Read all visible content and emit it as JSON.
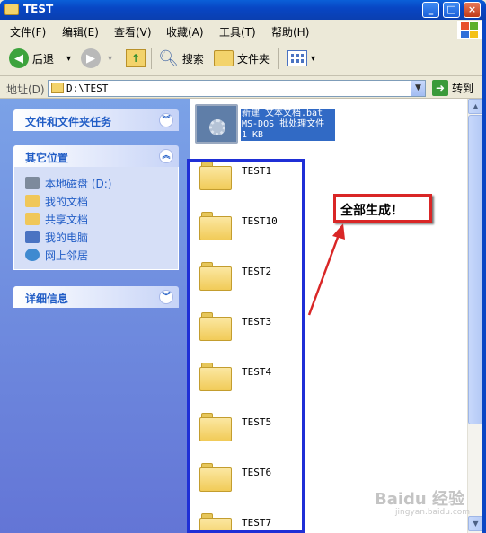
{
  "window": {
    "title": "TEST",
    "min_label": "_",
    "max_label": "□",
    "close_label": "×"
  },
  "menu": [
    "文件(F)",
    "编辑(E)",
    "查看(V)",
    "收藏(A)",
    "工具(T)",
    "帮助(H)"
  ],
  "toolbar": {
    "back_label": "后退",
    "back_arrow": "▾",
    "forward_arrow": "▾",
    "search_label": "搜索",
    "folders_label": "文件夹",
    "view_arrow": "▾"
  },
  "address": {
    "label": "地址(D)",
    "value": "D:\\TEST",
    "go_label": "转到"
  },
  "taskpane": {
    "file_tasks_title": "文件和文件夹任务",
    "other_places_title": "其它位置",
    "other_places": [
      {
        "label": "本地磁盘 (D:)",
        "icon": "drive-icon",
        "color": "#7d8a9c"
      },
      {
        "label": "我的文档",
        "icon": "my-documents-icon",
        "color": "#f0c75a"
      },
      {
        "label": "共享文档",
        "icon": "shared-documents-icon",
        "color": "#f0c75a"
      },
      {
        "label": "我的电脑",
        "icon": "my-computer-icon",
        "color": "#4a73c2"
      },
      {
        "label": "网上邻居",
        "icon": "network-icon",
        "color": "#3f8ad0"
      }
    ],
    "details_title": "详细信息",
    "collapse_glyph": "︽",
    "expand_glyph": "︾"
  },
  "files": {
    "bat": {
      "line1": "新建 文本文档.bat",
      "line2": "MS-DOS 批处理文件",
      "line3": "1 KB"
    },
    "folders": [
      "TEST1",
      "TEST10",
      "TEST2",
      "TEST3",
      "TEST4",
      "TEST5",
      "TEST6",
      "TEST7"
    ]
  },
  "annotation": {
    "callout_text": "全部生成！",
    "callout_color": "#d92626",
    "box_color": "#1f2fd6"
  },
  "watermark": {
    "brand": "Baidu 经验",
    "url": "jingyan.baidu.com"
  },
  "colors": {
    "title_bar": "#0846c4",
    "task_pane": "#6f8fe0",
    "selection": "#316ac5"
  }
}
